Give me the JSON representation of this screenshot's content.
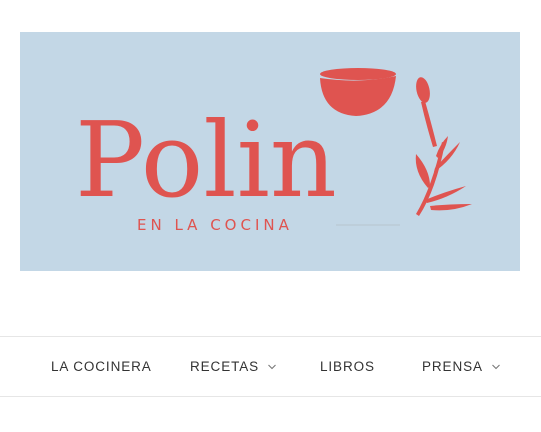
{
  "brand": {
    "name": "Polin",
    "tagline": "EN LA COCINA",
    "colors": {
      "banner_background": "#c3d7e6",
      "logo_red": "#df5450",
      "nav_text": "#333333"
    }
  },
  "nav": {
    "items": [
      {
        "label": "LA COCINERA",
        "has_dropdown": false
      },
      {
        "label": "RECETAS",
        "has_dropdown": true,
        "icon": "chevron-down-icon"
      },
      {
        "label": "LIBROS",
        "has_dropdown": false
      },
      {
        "label": "PRENSA",
        "has_dropdown": true,
        "icon": "chevron-down-icon"
      }
    ]
  }
}
